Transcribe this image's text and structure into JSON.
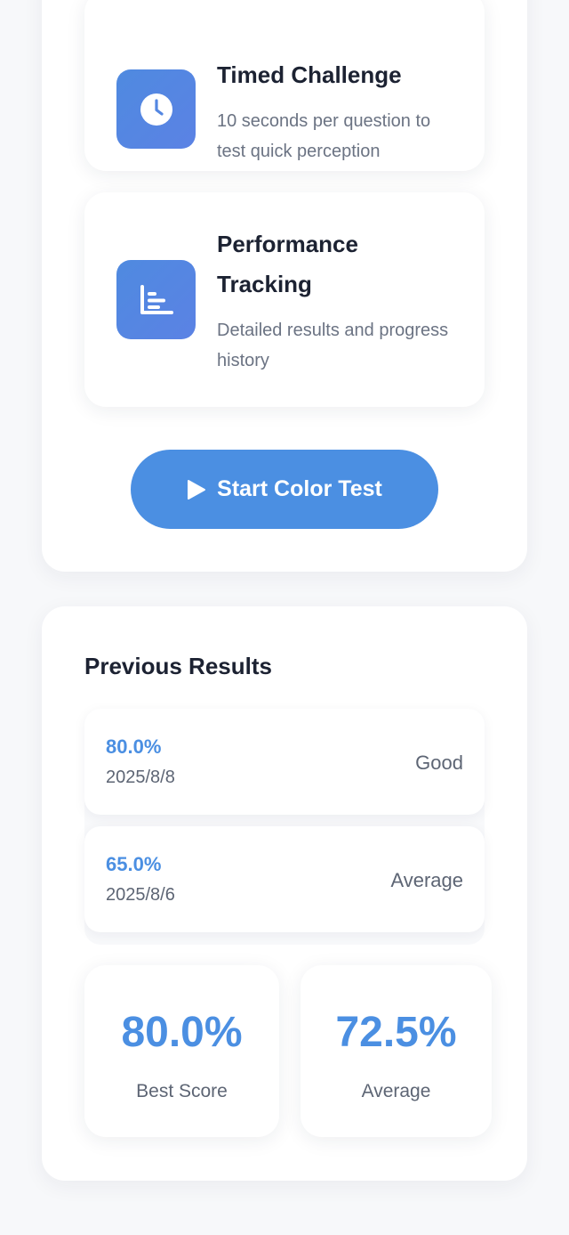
{
  "features": [
    {
      "title": "Timed Challenge",
      "description": "10 seconds per question to test quick perception",
      "icon": "clock-icon"
    },
    {
      "title": "Performance Tracking",
      "description": "Detailed results and progress history",
      "icon": "bar-chart-icon"
    }
  ],
  "start_button": {
    "label": "Start Color Test",
    "icon": "play-icon"
  },
  "results": {
    "title": "Previous Results",
    "items": [
      {
        "score": "80.0%",
        "date": "2025/8/8",
        "rating": "Good"
      },
      {
        "score": "65.0%",
        "date": "2025/8/6",
        "rating": "Average"
      }
    ],
    "stats": {
      "best": {
        "value": "80.0%",
        "label": "Best Score"
      },
      "average": {
        "value": "72.5%",
        "label": "Average"
      }
    }
  },
  "colors": {
    "accent": "#4b8fe2",
    "icon_gradient_start": "#4f8ae0",
    "icon_gradient_end": "#5b82e4",
    "background": "#f7f8fa"
  }
}
